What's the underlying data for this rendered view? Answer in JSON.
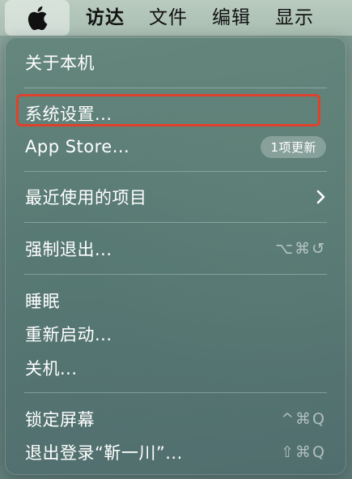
{
  "menubar": {
    "apple_icon": "apple-logo-icon",
    "items": [
      "访达",
      "文件",
      "编辑",
      "显示"
    ]
  },
  "menu": {
    "about": "关于本机",
    "system_settings": "系统设置...",
    "app_store": {
      "label": "App Store...",
      "badge": "1项更新"
    },
    "recent_items": {
      "label": "最近使用的项目",
      "chevron_icon": "chevron-right-icon"
    },
    "force_quit": {
      "label": "强制退出...",
      "shortcut": "⌥⌘↺"
    },
    "sleep": "睡眠",
    "restart": "重新启动...",
    "shutdown": "关机...",
    "lock_screen": {
      "label": "锁定屏幕",
      "shortcut": "^⌘Q"
    },
    "logout": {
      "label": "退出登录“靳一川”...",
      "shortcut": "⇧⌘Q"
    }
  },
  "colors": {
    "highlight_border": "#e0412b"
  }
}
